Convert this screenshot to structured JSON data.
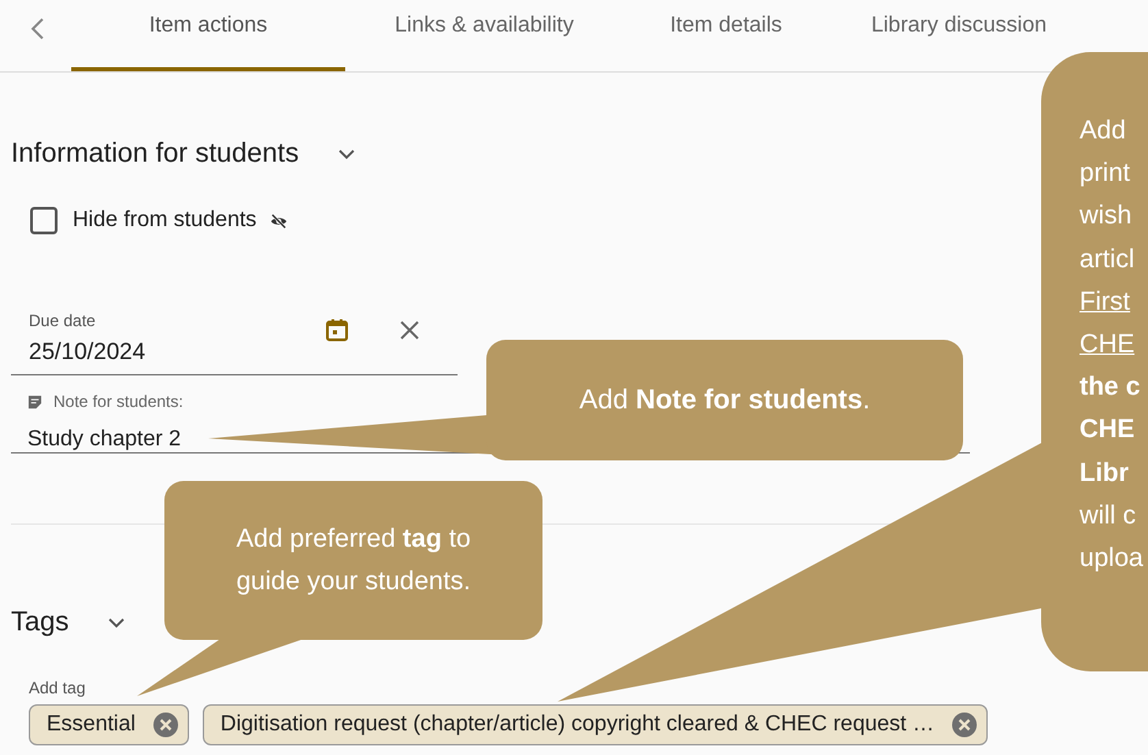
{
  "tabs": [
    {
      "label": "Item actions",
      "selected": true
    },
    {
      "label": "Links & availability",
      "selected": false
    },
    {
      "label": "Item details",
      "selected": false
    },
    {
      "label": "Library discussion",
      "selected": false
    }
  ],
  "information_section": {
    "title": "Information for students",
    "expanded": true
  },
  "hide_from_students": {
    "label": "Hide from students",
    "checked": false
  },
  "due_date": {
    "label": "Due date",
    "value": "25/10/2024"
  },
  "note": {
    "label": "Note for students:",
    "value": "Study chapter 2"
  },
  "tags_section": {
    "title": "Tags",
    "expanded": true
  },
  "add_tag": {
    "label": "Add tag"
  },
  "tags": [
    {
      "label": "Essential"
    },
    {
      "label": "Digitisation request (chapter/article) copyright cleared & CHEC request …"
    }
  ],
  "callouts": [
    {
      "text": "Add **Note for students**."
    },
    {
      "text": "Add preferred **tag** to guide your students."
    }
  ],
  "side_callout_lines": [
    {
      "kind": "plain",
      "text": "Add"
    },
    {
      "kind": "plain",
      "text": "print"
    },
    {
      "kind": "plain",
      "text": "wish"
    },
    {
      "kind": "plain",
      "text": "articl"
    },
    {
      "kind": "link",
      "text": "First"
    },
    {
      "kind": "link",
      "text": "CHE"
    },
    {
      "kind": "bold",
      "text": "the c"
    },
    {
      "kind": "bold",
      "text": "CHE"
    },
    {
      "kind": "bold",
      "text": "Libr"
    },
    {
      "kind": "plain",
      "text": "will c"
    },
    {
      "kind": "plain",
      "text": "uploa"
    }
  ]
}
